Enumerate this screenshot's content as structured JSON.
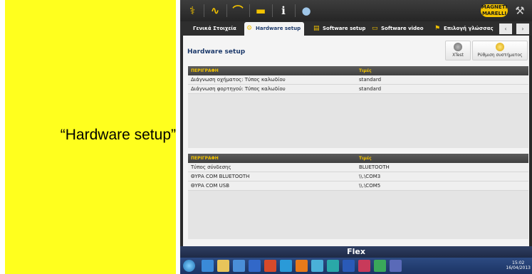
{
  "caption": "“Hardware setup”",
  "toolbar": {
    "brand": "MAGNETI MARELLI"
  },
  "tabs": [
    {
      "label": "Γενικά Στοιχεία",
      "active": false
    },
    {
      "label": "Hardware setup",
      "active": true
    },
    {
      "label": "Software setup",
      "active": false
    },
    {
      "label": "Software video",
      "active": false
    },
    {
      "label": "Επιλογή γλώσσας",
      "active": false
    }
  ],
  "page": {
    "title": "Hardware setup",
    "buttons": [
      {
        "label": "XTest",
        "icon": "xtest-icon"
      },
      {
        "label": "Ρύθμιση συστήματος",
        "icon": "system-settings-icon"
      }
    ]
  },
  "table1": {
    "headers": [
      "ΠΕΡΙΓΡΑΦΗ",
      "Τιμές"
    ],
    "rows": [
      [
        "Διάγνωση οχήματος: Τύπος καλωδίου",
        "standard"
      ],
      [
        "Διάγνωση φορτηγού: Τύπος καλωδίου",
        "standard"
      ]
    ]
  },
  "table2": {
    "headers": [
      "ΠΕΡΙΓΡΑΦΗ",
      "Τιμές"
    ],
    "rows": [
      [
        "Τύπος σύνδεσης",
        "BLUETOOTH"
      ],
      [
        "ΘΥΡΑ COM BLUETOOTH",
        "\\\\.\\COM3"
      ],
      [
        "ΘΥΡΑ COM USB",
        "\\\\.\\COM5"
      ]
    ]
  },
  "flex_label": "Flex",
  "clock": {
    "time": "15:02",
    "date": "16/04/2013"
  }
}
